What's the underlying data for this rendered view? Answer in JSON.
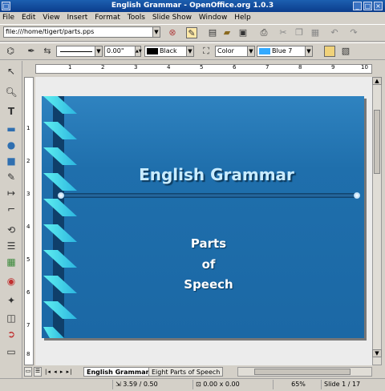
{
  "window": {
    "title": "English Grammar - OpenOffice.org 1.0.3"
  },
  "menu": [
    "File",
    "Edit",
    "View",
    "Insert",
    "Format",
    "Tools",
    "Slide Show",
    "Window",
    "Help"
  ],
  "toolbar": {
    "url": "file:///home/tigert/parts.pps"
  },
  "object_bar": {
    "line_width": "0.00\"",
    "line_color": "Black",
    "line_color_hex": "#000000",
    "area_style": "Color",
    "area_color": "Blue 7",
    "area_color_hex": "#33aaff"
  },
  "ruler_h": [
    "1",
    "2",
    "3",
    "4",
    "5",
    "6",
    "7",
    "8",
    "9",
    "10"
  ],
  "ruler_v": [
    "1",
    "2",
    "3",
    "4",
    "5",
    "6",
    "7",
    "8"
  ],
  "slide": {
    "title": "English Grammar",
    "subtitle_lines": [
      "Parts",
      "of",
      "Speech"
    ],
    "bg_color": "#1f6fac",
    "title_color": "#c9ecff"
  },
  "tabs": [
    "English Grammar",
    "Eight Parts of Speech"
  ],
  "status": {
    "position": "3.59 / 0.50",
    "size": "0.00 x 0.00",
    "zoom": "65%",
    "slide": "Slide 1 / 17"
  }
}
